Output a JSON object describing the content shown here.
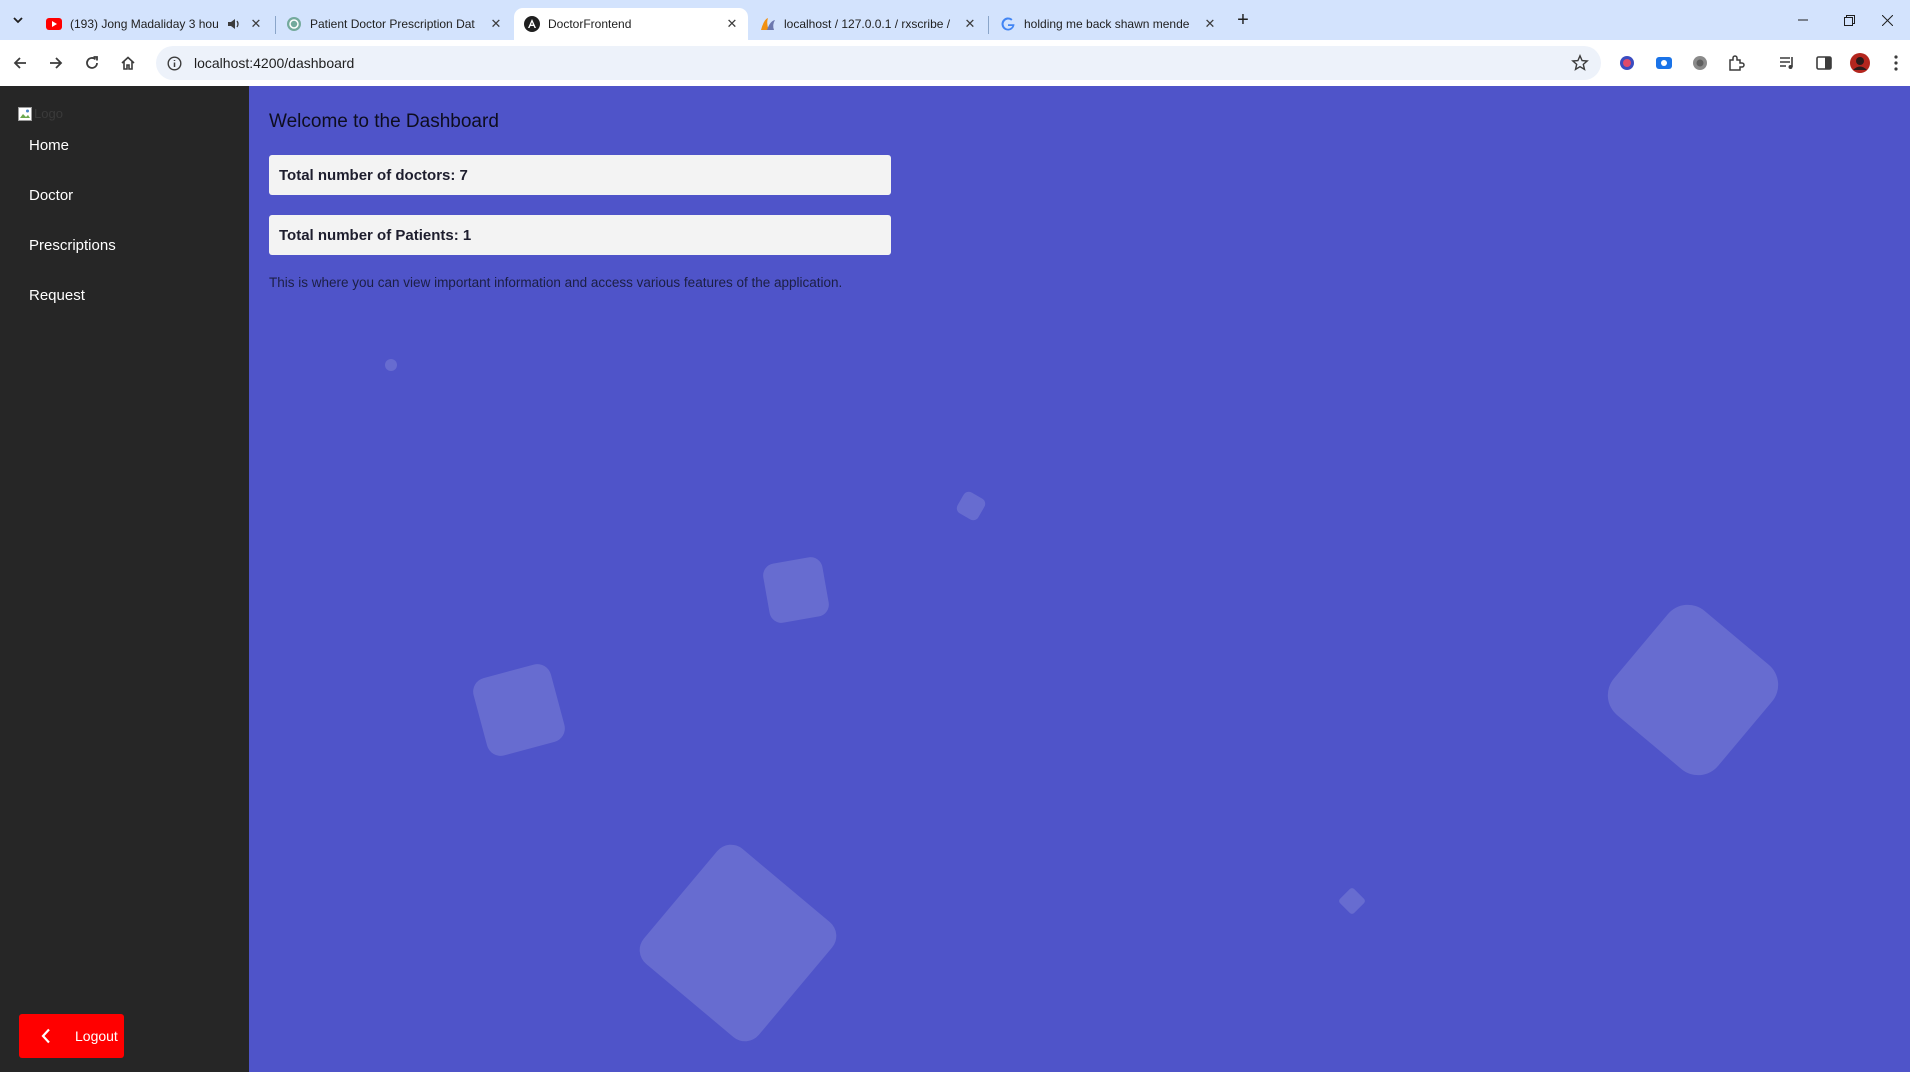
{
  "browser": {
    "tabs": [
      {
        "title": "(193) Jong Madaliday 3 hou",
        "favicon": "youtube-icon",
        "audio": true,
        "active": false
      },
      {
        "title": "Patient Doctor Prescription Dat",
        "favicon": "chatgpt-icon",
        "audio": false,
        "active": false
      },
      {
        "title": "DoctorFrontend",
        "favicon": "angular-icon",
        "audio": false,
        "active": true
      },
      {
        "title": "localhost / 127.0.0.1 / rxscribe /",
        "favicon": "phpmyadmin-icon",
        "audio": false,
        "active": false
      },
      {
        "title": "holding me back shawn mende",
        "favicon": "google-icon",
        "audio": false,
        "active": false
      }
    ],
    "url": "localhost:4200/dashboard"
  },
  "sidebar": {
    "logo_alt": "Logo",
    "items": [
      {
        "label": "Home"
      },
      {
        "label": "Doctor"
      },
      {
        "label": "Prescriptions"
      },
      {
        "label": "Request"
      }
    ],
    "logout_label": "Logout"
  },
  "main": {
    "title": "Welcome to the Dashboard",
    "stats": {
      "doctors_label": "Total number of doctors: 7",
      "patients_label": "Total number of Patients: 1"
    },
    "description": "This is where you can view important information and access various features of the application."
  },
  "colors": {
    "sidebar_bg": "#262626",
    "main_bg": "#4f54c9",
    "logout_bg": "#ff0000",
    "card_bg": "#f3f3f3"
  }
}
